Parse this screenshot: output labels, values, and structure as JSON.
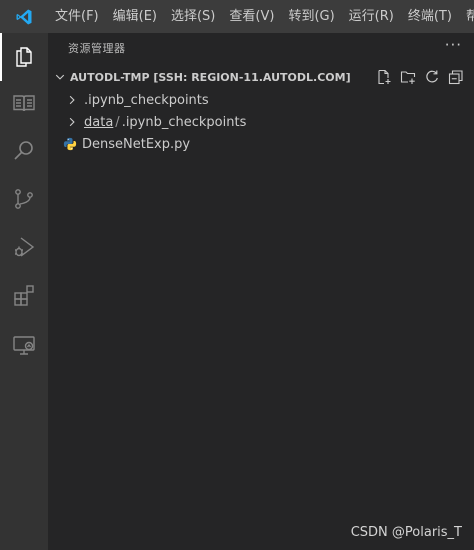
{
  "menu": [
    "文件(F)",
    "编辑(E)",
    "选择(S)",
    "查看(V)",
    "转到(G)",
    "运行(R)",
    "终端(T)",
    "帮助"
  ],
  "activity_bar": [
    {
      "icon": "explorer-icon",
      "active": true
    },
    {
      "icon": "notebook-icon",
      "active": false
    },
    {
      "icon": "search-icon",
      "active": false
    },
    {
      "icon": "source-control-icon",
      "active": false
    },
    {
      "icon": "run-debug-icon",
      "active": false
    },
    {
      "icon": "extensions-icon",
      "active": false
    },
    {
      "icon": "remote-explorer-icon",
      "active": false
    }
  ],
  "sidebar": {
    "title": "资源管理器",
    "more": "···",
    "section": {
      "title": "AUTODL-TMP [SSH: REGION-11.AUTODL.COM]",
      "actions": [
        "new-file-icon",
        "new-folder-icon",
        "refresh-icon",
        "collapse-all-icon"
      ]
    },
    "tree": [
      {
        "name": ".ipynb_checkpoints"
      },
      {
        "parent": "data",
        "separator": "/",
        "name": ".ipynb_checkpoints"
      },
      {
        "name": "DenseNetExp.py",
        "icon": "python-file-icon"
      }
    ]
  },
  "watermark": "CSDN @Polaris_T",
  "colors": {
    "titlebar": "#3c3c3c",
    "activitybar": "#333333",
    "sidebar": "#252526",
    "foreground": "#cccccc",
    "python_blue": "#3572a5",
    "python_yellow": "#ffd343",
    "vscode_blue": "#23a9f2"
  }
}
